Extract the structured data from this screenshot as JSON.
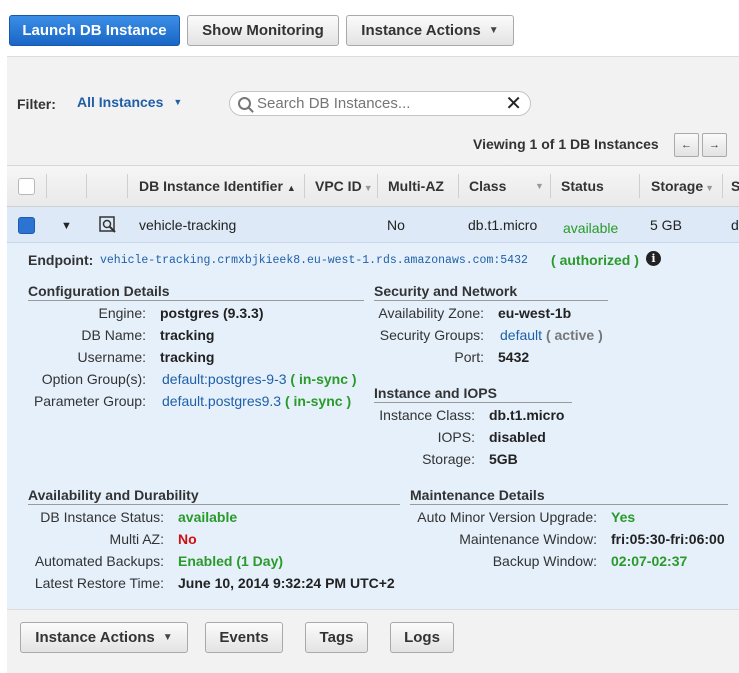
{
  "toolbar": {
    "launch": "Launch DB Instance",
    "monitoring": "Show Monitoring",
    "actions": "Instance Actions"
  },
  "filter": {
    "label": "Filter:",
    "selected": "All Instances",
    "search_placeholder": "Search DB Instances..."
  },
  "pagination": {
    "viewing": "Viewing 1 of 1 DB Instances",
    "prev": "←",
    "next": "→"
  },
  "table": {
    "columns": [
      "DB Instance Identifier",
      "VPC ID",
      "Multi-AZ",
      "Class",
      "Status",
      "Storage",
      "S"
    ],
    "row": {
      "identifier": "vehicle-tracking",
      "multi_az": "No",
      "class": "db.t1.micro",
      "status": "available",
      "storage": "5 GB",
      "cut": "d"
    }
  },
  "details": {
    "endpoint_label": "Endpoint:",
    "endpoint": "vehicle-tracking.crmxbjkieek8.eu-west-1.rds.amazonaws.com:5432",
    "endpoint_status": "authorized",
    "config": {
      "title": "Configuration Details",
      "engine_label": "Engine:",
      "engine": "postgres (9.3.3)",
      "dbname_label": "DB Name:",
      "dbname": "tracking",
      "username_label": "Username:",
      "username": "tracking",
      "option_label": "Option Group(s):",
      "option": "default:postgres-9-3",
      "option_status": "in-sync",
      "param_label": "Parameter Group:",
      "param": "default.postgres9.3",
      "param_status": "in-sync"
    },
    "security": {
      "title": "Security and Network",
      "az_label": "Availability Zone:",
      "az": "eu-west-1b",
      "sg_label": "Security Groups:",
      "sg": "default",
      "sg_status": "active",
      "port_label": "Port:",
      "port": "5432"
    },
    "iops": {
      "title": "Instance and IOPS",
      "class_label": "Instance Class:",
      "class": "db.t1.micro",
      "iops_label": "IOPS:",
      "iops": "disabled",
      "storage_label": "Storage:",
      "storage": "5GB"
    },
    "availability": {
      "title": "Availability and Durability",
      "status_label": "DB Instance Status:",
      "status": "available",
      "multiaz_label": "Multi AZ:",
      "multiaz": "No",
      "backups_label": "Automated Backups:",
      "backups": "Enabled (1 Day)",
      "restore_label": "Latest Restore Time:",
      "restore": "June 10, 2014 9:32:24 PM UTC+2"
    },
    "maintenance": {
      "title": "Maintenance Details",
      "upgrade_label": "Auto Minor Version Upgrade:",
      "upgrade": "Yes",
      "window_label": "Maintenance Window:",
      "window": "fri:05:30-fri:06:00",
      "backup_label": "Backup Window:",
      "backup": "02:07-02:37"
    }
  },
  "footer": {
    "actions": "Instance Actions",
    "events": "Events",
    "tags": "Tags",
    "logs": "Logs"
  }
}
